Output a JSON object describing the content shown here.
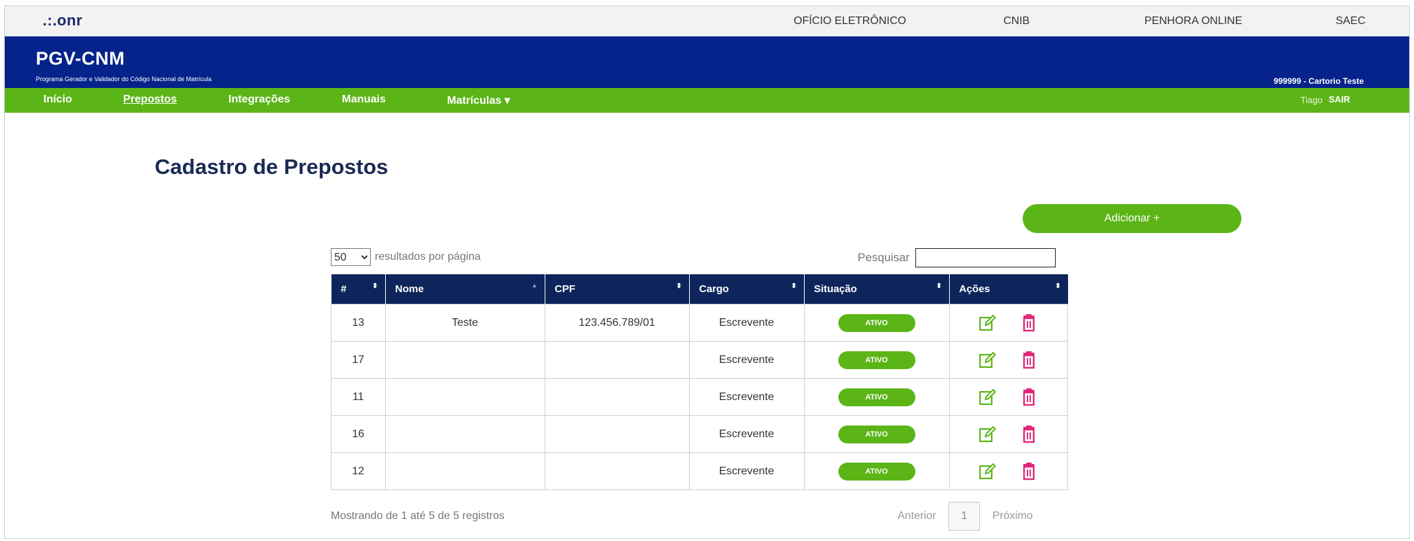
{
  "topbar": {
    "logo": ".:.onr",
    "links": [
      "OFÍCIO ELETRÔNICO",
      "CNIB",
      "PENHORA ONLINE",
      "SAEC"
    ]
  },
  "header": {
    "title": "PGV-CNM",
    "subtitle": "Programa Gerador e Validador do Código Nacional de Matrícula",
    "office": "999999 - Cartorio Teste"
  },
  "nav": {
    "items": [
      "Início",
      "Prepostos",
      "Integrações",
      "Manuais",
      "Matrículas ▾"
    ],
    "active": "Prepostos",
    "user": "Tiago",
    "logout": "SAIR"
  },
  "page": {
    "title": "Cadastro de Prepostos",
    "add_label": "Adicionar +",
    "length_value": "50",
    "length_label": "resultados por página",
    "search_label": "Pesquisar",
    "search_value": ""
  },
  "table": {
    "columns": [
      "#",
      "Nome",
      "CPF",
      "Cargo",
      "Situação",
      "Ações"
    ],
    "rows": [
      {
        "id": "13",
        "nome": "Teste",
        "cpf": "123.456.789/01",
        "cargo": "Escrevente",
        "situacao": "ATIVO"
      },
      {
        "id": "17",
        "nome": "",
        "cpf": "",
        "cargo": "Escrevente",
        "situacao": "ATIVO"
      },
      {
        "id": "11",
        "nome": "",
        "cpf": "",
        "cargo": "Escrevente",
        "situacao": "ATIVO"
      },
      {
        "id": "16",
        "nome": "",
        "cpf": "",
        "cargo": "Escrevente",
        "situacao": "ATIVO"
      },
      {
        "id": "12",
        "nome": "",
        "cpf": "",
        "cargo": "Escrevente",
        "situacao": "ATIVO"
      }
    ]
  },
  "footer": {
    "info": "Mostrando de 1 até 5 de 5 registros",
    "prev": "Anterior",
    "page": "1",
    "next": "Próximo"
  },
  "colors": {
    "blue_header": "#05238b",
    "green": "#5cb517",
    "table_header": "#0d255a",
    "delete_icon": "#e0287a",
    "edit_icon": "#5cb517"
  }
}
